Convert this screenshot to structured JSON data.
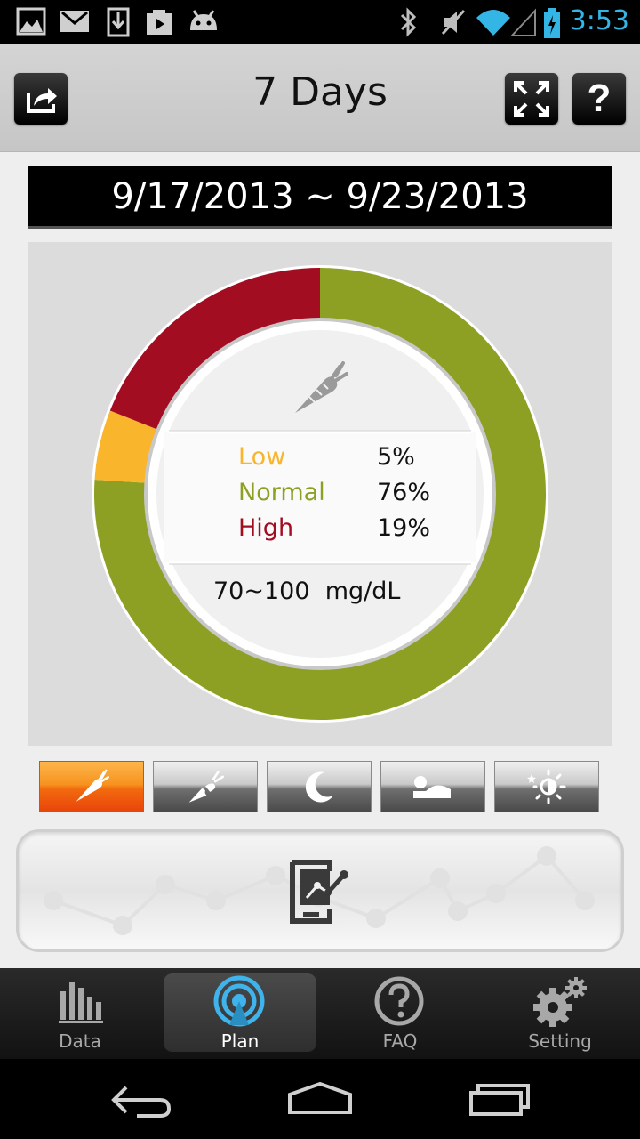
{
  "status_bar": {
    "time": "3:53",
    "icons": [
      "gallery-icon",
      "gmail-icon",
      "download-icon",
      "play-store-icon",
      "android-icon",
      "bluetooth-icon",
      "mute-icon",
      "wifi-icon",
      "signal-icon",
      "battery-icon"
    ]
  },
  "header": {
    "title": "7 Days",
    "share_icon": "share-icon",
    "expand_icon": "fullscreen-icon",
    "help_icon": "help-icon"
  },
  "date_range": "9/17/2013 ~ 9/23/2013",
  "chart_data": {
    "type": "pie",
    "categories": [
      "Low",
      "Normal",
      "High"
    ],
    "values": [
      5,
      76,
      19
    ],
    "colors": [
      "#f9b52b",
      "#8ea023",
      "#a30d22"
    ],
    "labels": [
      "5%",
      "76%",
      "19%"
    ]
  },
  "summary": {
    "rows": [
      {
        "name": "Low",
        "pct": "5%",
        "color": "#f9b52b"
      },
      {
        "name": "Normal",
        "pct": "76%",
        "color": "#8ea023"
      },
      {
        "name": "High",
        "pct": "19%",
        "color": "#a30d22"
      }
    ],
    "range": "70~100",
    "unit": "mg/dL",
    "center_icon": "carrot-icon"
  },
  "meal_tabs": [
    {
      "icon": "carrot-icon",
      "active": true
    },
    {
      "icon": "eaten-carrot-icon",
      "active": false
    },
    {
      "icon": "moon-icon",
      "active": false
    },
    {
      "icon": "sleeping-icon",
      "active": false
    },
    {
      "icon": "sun-icon",
      "active": false
    }
  ],
  "trend_button": {
    "icon": "tablet-trend-icon"
  },
  "bottom_nav": [
    {
      "label": "Data",
      "icon": "bar-chart-icon",
      "active": false
    },
    {
      "label": "Plan",
      "icon": "plan-target-icon",
      "active": true
    },
    {
      "label": "FAQ",
      "icon": "question-icon",
      "active": false
    },
    {
      "label": "Setting",
      "icon": "gear-icon",
      "active": false
    }
  ],
  "system_nav": [
    "back-icon",
    "home-icon",
    "recents-icon"
  ]
}
